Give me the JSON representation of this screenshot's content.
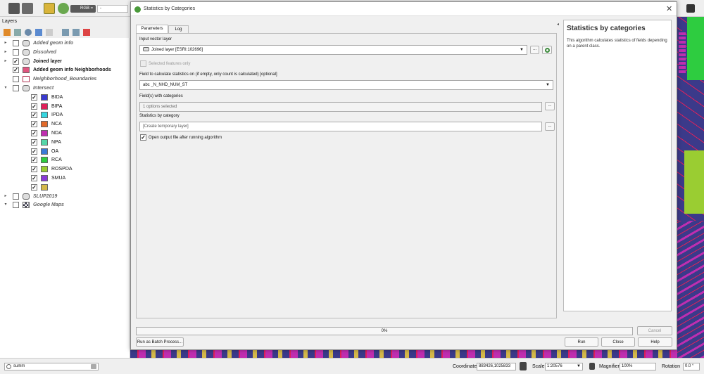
{
  "toolbar": {
    "rgb_label": "RGB =",
    "rgb_value": "-"
  },
  "layers_panel": {
    "title": "Layers",
    "items": [
      {
        "label": "Added geom info",
        "checked": false,
        "expander": "▸",
        "style": "italic",
        "icon": "polygon-layer-icon"
      },
      {
        "label": "Dissolved",
        "checked": false,
        "expander": "▸",
        "style": "italic",
        "icon": "polygon-layer-icon"
      },
      {
        "label": "Joined layer",
        "checked": true,
        "expander": "▸",
        "style": "bold",
        "icon": "polygon-layer-icon"
      },
      {
        "label": "Added geom info Neighborhoods",
        "checked": true,
        "expander": "",
        "style": "bold",
        "icon": "swatch",
        "color": "#e0557f"
      },
      {
        "label": "Neighborhood_Boundaries",
        "checked": false,
        "expander": "",
        "style": "italic",
        "icon": "swatch",
        "color": "#ffffff",
        "border": "#b03050"
      },
      {
        "label": "Intersect",
        "checked": false,
        "expander": "▾",
        "style": "italic",
        "icon": "polygon-layer-icon"
      },
      {
        "label": "BIDA",
        "checked": true,
        "indent": true,
        "icon": "swatch",
        "color": "#3a3ad0"
      },
      {
        "label": "BIPA",
        "checked": true,
        "indent": true,
        "icon": "swatch",
        "color": "#e0205a"
      },
      {
        "label": "IPDA",
        "checked": true,
        "indent": true,
        "icon": "swatch",
        "color": "#35d6e0"
      },
      {
        "label": "NCA",
        "checked": true,
        "indent": true,
        "icon": "swatch",
        "color": "#e26a2a"
      },
      {
        "label": "NDA",
        "checked": true,
        "indent": true,
        "icon": "swatch",
        "color": "#c02eb0"
      },
      {
        "label": "NPA",
        "checked": true,
        "indent": true,
        "icon": "swatch",
        "color": "#55d6a8"
      },
      {
        "label": "OA",
        "checked": true,
        "indent": true,
        "icon": "swatch",
        "color": "#3a7ad6"
      },
      {
        "label": "RCA",
        "checked": true,
        "indent": true,
        "icon": "swatch",
        "color": "#2ecc40"
      },
      {
        "label": "ROSPDA",
        "checked": true,
        "indent": true,
        "icon": "swatch",
        "color": "#9acd32"
      },
      {
        "label": "SMUA",
        "checked": true,
        "indent": true,
        "icon": "swatch",
        "color": "#8a3ad6"
      },
      {
        "label": "",
        "checked": true,
        "indent": true,
        "icon": "swatch",
        "color": "#d4b84a"
      },
      {
        "label": "SLUP2019",
        "checked": false,
        "expander": "▸",
        "style": "italic",
        "icon": "polygon-layer-icon"
      },
      {
        "label": "Google Maps",
        "checked": false,
        "expander": "▾",
        "style": "italic",
        "icon": "raster-layer-icon"
      }
    ]
  },
  "dialog": {
    "title": "Statistics by Categories",
    "tabs": [
      "Parameters",
      "Log"
    ],
    "input_layer_label": "Input vector layer",
    "input_layer_value": "Joined layer [ESRI:102696]",
    "selected_only_label": "Selected features only",
    "field_label": "Field to calculate statistics on (if empty, only count is calculated) [optional]",
    "field_value": "abc _N_NHD_NUM_ST",
    "categories_label": "Field(s) with categories",
    "categories_value": "1 options selected",
    "output_label": "Statistics by category",
    "output_value": "[Create temporary layer]",
    "open_output_label": "Open output file after running algorithm",
    "help_title": "Statistics by categories",
    "help_body": "This algorithm calculates statistics of fields depending on a parent class.",
    "progress": "0%",
    "cancel": "Cancel",
    "batch": "Run as Batch Process...",
    "run": "Run",
    "close": "Close",
    "help": "Help",
    "ellipsis": "..."
  },
  "statusbar": {
    "search_value": "summ",
    "coordinate_label": "Coordinate",
    "coordinate_value": "883426,1025833",
    "scale_label": "Scale",
    "scale_value": "1:20576",
    "magnifier_label": "Magnifier",
    "magnifier_value": "100%",
    "rotation_label": "Rotation",
    "rotation_value": "0.0 °"
  }
}
